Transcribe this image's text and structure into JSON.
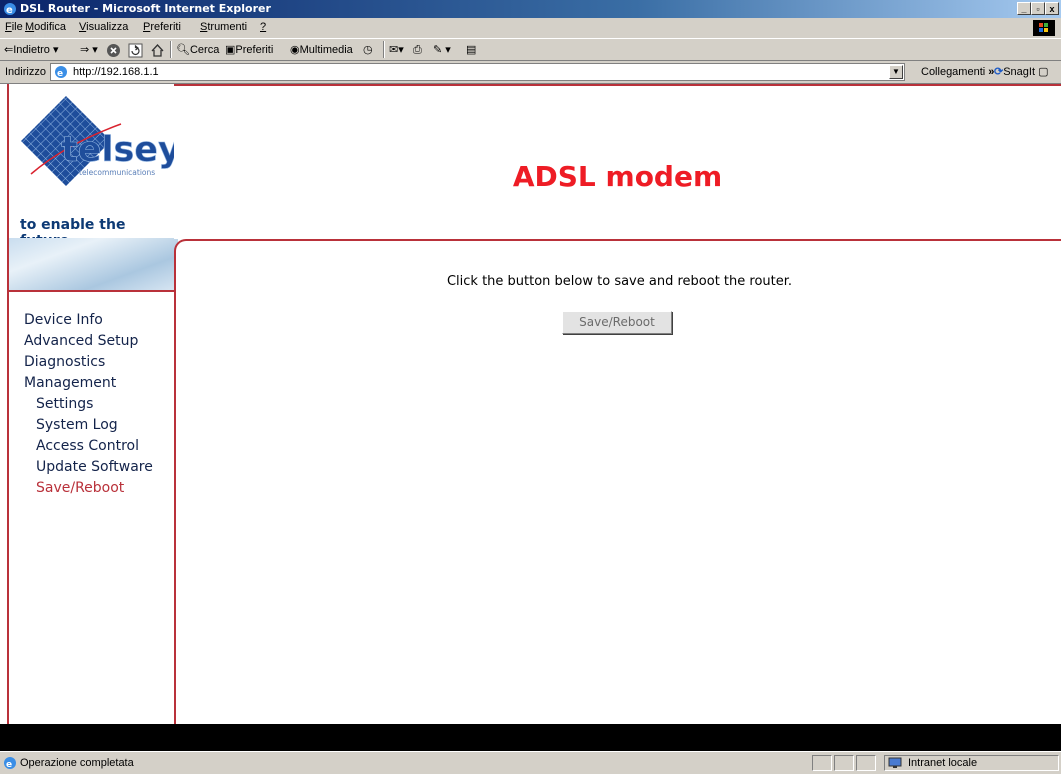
{
  "window": {
    "title": "DSL Router - Microsoft Internet Explorer",
    "controls": [
      "_",
      "▫",
      "x"
    ]
  },
  "menu": {
    "items": [
      {
        "mnemonic": "F",
        "rest": "ile"
      },
      {
        "mnemonic": "M",
        "rest": "odifica"
      },
      {
        "mnemonic": "V",
        "rest": "isualizza"
      },
      {
        "mnemonic": "P",
        "rest": "referiti"
      },
      {
        "mnemonic": "S",
        "rest": "trumenti"
      },
      {
        "mnemonic": "?",
        "rest": ""
      }
    ]
  },
  "toolbar": {
    "back": "Indietro",
    "search": "Cerca",
    "favorites": "Preferiti",
    "media": "Multimedia"
  },
  "address": {
    "label": "Indirizzo",
    "url": "http://192.168.1.1",
    "links_label": "Collegamenti",
    "snagit": "SnagIt"
  },
  "page": {
    "logo_brand": "telsey",
    "logo_sub": "telecommunications",
    "logo_tagline": "to enable the future",
    "heading": "ADSL modem",
    "instruction": "Click the button below to save and reboot the router.",
    "button_label": "Save/Reboot",
    "nav": [
      {
        "label": "Device Info",
        "level": 0
      },
      {
        "label": "Advanced Setup",
        "level": 0
      },
      {
        "label": "Diagnostics",
        "level": 0
      },
      {
        "label": "Management",
        "level": 0
      },
      {
        "label": "Settings",
        "level": 1
      },
      {
        "label": "System Log",
        "level": 1
      },
      {
        "label": "Access Control",
        "level": 1
      },
      {
        "label": "Update Software",
        "level": 1
      },
      {
        "label": "Save/Reboot",
        "level": 1,
        "active": true
      }
    ]
  },
  "status": {
    "text": "Operazione completata",
    "zone": "Intranet locale"
  },
  "colors": {
    "accent_red": "#ee1c25",
    "frame_red": "#b9313a",
    "nav_text": "#13234a",
    "logo_blue": "#1e4d9b"
  }
}
